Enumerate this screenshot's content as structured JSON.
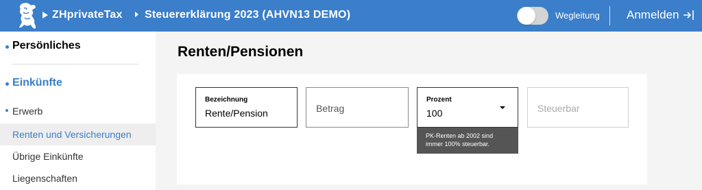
{
  "header": {
    "app_name": "ZHprivateTax",
    "title": "Steuererklärung 2023 (AHVN13 DEMO)",
    "wegleitung_label": "Wegleitung",
    "login_label": "Anmelden",
    "logo": "lion-crest-logo",
    "colors": {
      "brand": "#3b7ec9"
    }
  },
  "sidebar": {
    "sections": [
      {
        "label": "Persönliches",
        "color": "#000000"
      },
      {
        "label": "Einkünfte",
        "color": "#3b7ec9"
      }
    ],
    "items": [
      {
        "label": "Erwerb"
      },
      {
        "label": "Renten und Versicherungen",
        "active": true,
        "color": "#3b7ec9"
      },
      {
        "label": "Übrige Einkünfte"
      },
      {
        "label": "Liegenschaften"
      }
    ]
  },
  "main": {
    "page_title": "Renten/Pensionen",
    "fields": [
      {
        "label": "Bezeichnung",
        "value": "Rente/Pension"
      },
      {
        "placeholder": "Betrag"
      },
      {
        "label": "Prozent",
        "value": "100",
        "type": "select"
      },
      {
        "placeholder": "Steuerbar",
        "disabled": true
      }
    ],
    "tooltip": {
      "line1": "PK-Renten ab 2002 sind",
      "line2": "immer 100% steuerbar."
    }
  }
}
